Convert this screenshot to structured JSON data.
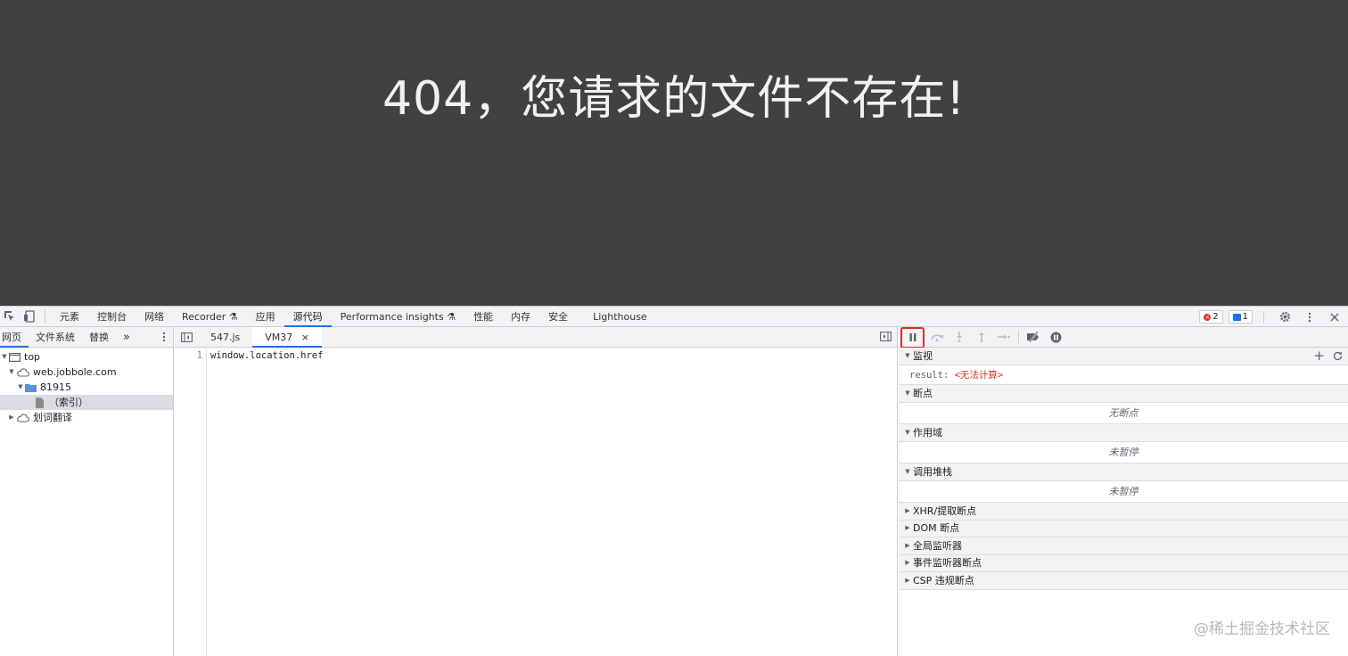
{
  "page": {
    "message": "404，您请求的文件不存在!"
  },
  "topbar": {
    "tabs": [
      {
        "label": "元素"
      },
      {
        "label": "控制台"
      },
      {
        "label": "网络"
      },
      {
        "label": "Recorder"
      },
      {
        "label": "应用"
      },
      {
        "label": "源代码",
        "active": true
      },
      {
        "label": "Performance insights"
      },
      {
        "label": "性能"
      },
      {
        "label": "内存"
      },
      {
        "label": "安全"
      },
      {
        "label": "Lighthouse"
      }
    ],
    "error_count": "2",
    "message_count": "1"
  },
  "navigator": {
    "tabs": [
      {
        "label": "网页"
      },
      {
        "label": "文件系统"
      },
      {
        "label": "替换"
      }
    ],
    "more": "»",
    "tree": [
      {
        "label": "top"
      },
      {
        "label": "web.jobbole.com"
      },
      {
        "label": "81915"
      },
      {
        "label": "（索引）"
      },
      {
        "label": "划词翻译"
      }
    ]
  },
  "editor": {
    "tabs": [
      {
        "label": "547.js"
      },
      {
        "label": "VM37"
      }
    ],
    "close_glyph": "×",
    "line_number": "1",
    "code": "window.location.href"
  },
  "debugger": {
    "watch": {
      "title": "监视",
      "key": "result:",
      "value": "<无法计算>"
    },
    "breakpoints": {
      "title": "断点",
      "empty": "无断点"
    },
    "scope": {
      "title": "作用域",
      "empty": "未暂停"
    },
    "callstack": {
      "title": "调用堆栈",
      "empty": "未暂停"
    },
    "collapsed": [
      {
        "title": "XHR/提取断点"
      },
      {
        "title": "DOM 断点"
      },
      {
        "title": "全局监听器"
      },
      {
        "title": "事件监听器断点"
      },
      {
        "title": "CSP 违规断点"
      }
    ]
  },
  "watermark": "@稀土掘金技术社区",
  "colors": {
    "accent": "#1a73e8",
    "error": "#d93025",
    "page_bg": "#414141"
  }
}
